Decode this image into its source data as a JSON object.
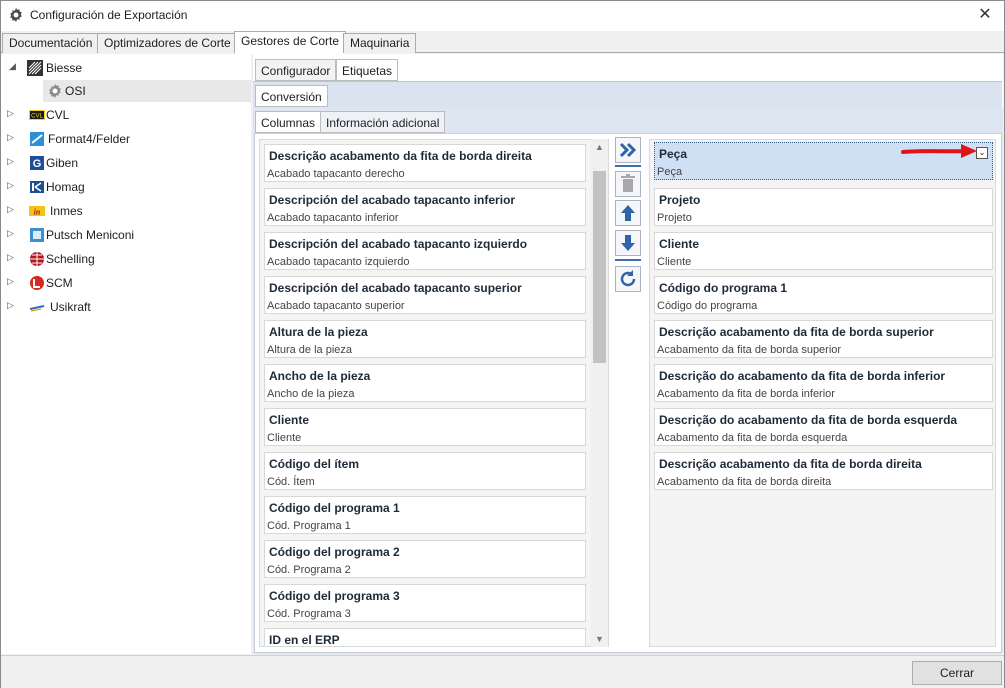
{
  "window": {
    "title": "Configuración de Exportación",
    "close_glyph": "✕"
  },
  "top_tabs": [
    {
      "label": "Documentación"
    },
    {
      "label": "Optimizadores de Corte"
    },
    {
      "label": "Gestores de Corte",
      "active": true
    },
    {
      "label": "Maquinaria"
    }
  ],
  "tree": [
    {
      "label": "Biesse",
      "expander": "◢",
      "icon": "biesse-logo"
    },
    {
      "label": "OSI",
      "icon": "gear-icon",
      "selected": true
    },
    {
      "label": "CVL",
      "expander": "▷",
      "icon": "cvl-logo"
    },
    {
      "label": "Format4/Felder",
      "expander": "▷",
      "icon": "format4-logo"
    },
    {
      "label": "Giben",
      "expander": "▷",
      "icon": "giben-logo"
    },
    {
      "label": "Homag",
      "expander": "▷",
      "icon": "homag-logo"
    },
    {
      "label": "Inmes",
      "expander": "▷",
      "icon": "inmes-logo"
    },
    {
      "label": "Putsch Meniconi",
      "expander": "▷",
      "icon": "putsch-logo"
    },
    {
      "label": "Schelling",
      "expander": "▷",
      "icon": "schelling-logo"
    },
    {
      "label": "SCM",
      "expander": "▷",
      "icon": "scm-logo"
    },
    {
      "label": "Usikraft",
      "expander": "▷",
      "icon": "usikraft-logo"
    }
  ],
  "sub_tabs": {
    "configurador": "Configurador",
    "etiquetas": "Etiquetas"
  },
  "conversion_tab": "Conversión",
  "inner_tabs": {
    "columnas": "Columnas",
    "info": "Información adicional"
  },
  "available_columns": [
    {
      "title": "Descrição acabamento da fita de borda direita",
      "subtitle": "Acabado tapacanto derecho"
    },
    {
      "title": "Descripción del acabado tapacanto inferior",
      "subtitle": "Acabado tapacanto inferior"
    },
    {
      "title": "Descripción del acabado tapacanto izquierdo",
      "subtitle": "Acabado tapacanto izquierdo"
    },
    {
      "title": "Descripción del acabado tapacanto superior",
      "subtitle": "Acabado tapacanto superior"
    },
    {
      "title": "Altura de la pieza",
      "subtitle": "Altura de la pieza"
    },
    {
      "title": "Ancho de la pieza",
      "subtitle": "Ancho de la pieza"
    },
    {
      "title": "Cliente",
      "subtitle": "Cliente"
    },
    {
      "title": "Código del ítem",
      "subtitle": "Cód. Ítem"
    },
    {
      "title": "Código del programa 1",
      "subtitle": "Cód. Programa 1"
    },
    {
      "title": "Código del programa 2",
      "subtitle": "Cód. Programa 2"
    },
    {
      "title": "Código del programa 3",
      "subtitle": "Cód. Programa 3"
    },
    {
      "title": "ID en el ERP",
      "subtitle": ""
    }
  ],
  "selected_columns": [
    {
      "title": "Peça",
      "subtitle": "Peça",
      "selected": true
    },
    {
      "title": "Projeto",
      "subtitle": "Projeto"
    },
    {
      "title": "Cliente",
      "subtitle": "Cliente"
    },
    {
      "title": "Código do programa 1",
      "subtitle": "Código do programa"
    },
    {
      "title": "Descrição acabamento da fita de borda superior",
      "subtitle": "Acabamento da fita de borda superior"
    },
    {
      "title": "Descrição do acabamento da fita de borda inferior",
      "subtitle": "Acabamento da fita de borda inferior"
    },
    {
      "title": "Descrição do acabamento da fita de borda esquerda",
      "subtitle": "Acabamento da fita de borda esquerda"
    },
    {
      "title": "Descrição acabamento da fita de borda direita",
      "subtitle": "Acabamento da fita de borda direita"
    }
  ],
  "middle_buttons": [
    "add-all-icon",
    "delete-icon",
    "move-up-icon",
    "move-down-icon",
    "refresh-icon"
  ],
  "footer": {
    "close_label": "Cerrar"
  },
  "colors": {
    "accent": "#2f65a8",
    "selection": "#cfe0f5",
    "annotation_arrow": "#e0121a"
  }
}
